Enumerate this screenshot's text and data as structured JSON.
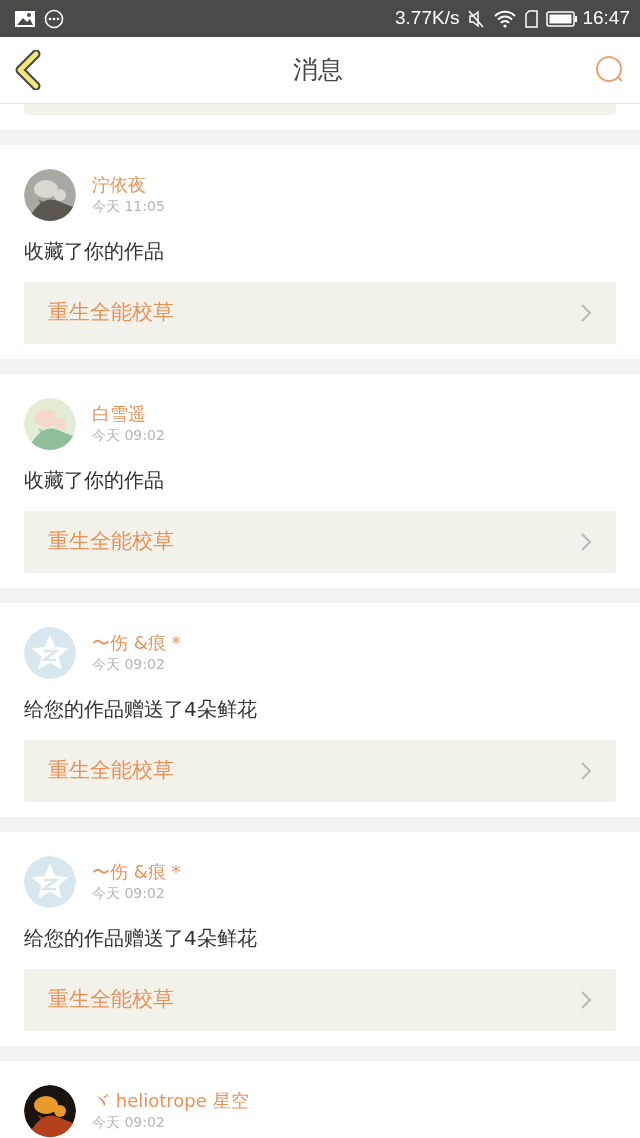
{
  "status_bar": {
    "speed": "3.77K/s",
    "time": "16:47"
  },
  "header": {
    "title": "消息"
  },
  "messages": [
    {
      "name": "泞依夜",
      "time": "今天 11:05",
      "text": "收藏了你的作品",
      "work": "重生全能校草"
    },
    {
      "name": "白雪遥",
      "time": "今天 09:02",
      "text": "收藏了你的作品",
      "work": "重生全能校草"
    },
    {
      "avatar": {
        "kind": "default"
      },
      "name": "〜伤 &痕 *",
      "time": "今天 09:02",
      "text": "给您的作品赠送了4朵鲜花",
      "work": "重生全能校草"
    },
    {
      "avatar": {
        "kind": "default"
      },
      "name": "〜伤 &痕 *",
      "time": "今天 09:02",
      "text": "给您的作品赠送了4朵鲜花",
      "work": "重生全能校草"
    },
    {
      "name": "ヾ heliotrope 星空",
      "time": "今天 09:02"
    }
  ]
}
